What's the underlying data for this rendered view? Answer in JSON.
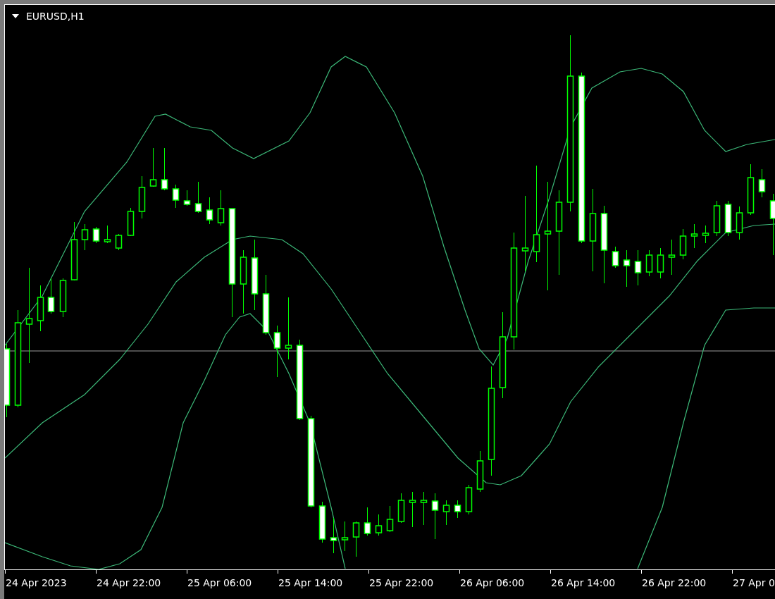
{
  "chart": {
    "title": "EURUSD,H1",
    "time_labels": [
      "24 Apr 2023",
      "24 Apr 22:00",
      "25 Apr 06:00",
      "25 Apr 14:00",
      "25 Apr 22:00",
      "26 Apr 06:00",
      "26 Apr 14:00",
      "26 Apr 22:00",
      "27 Apr 0"
    ]
  }
}
